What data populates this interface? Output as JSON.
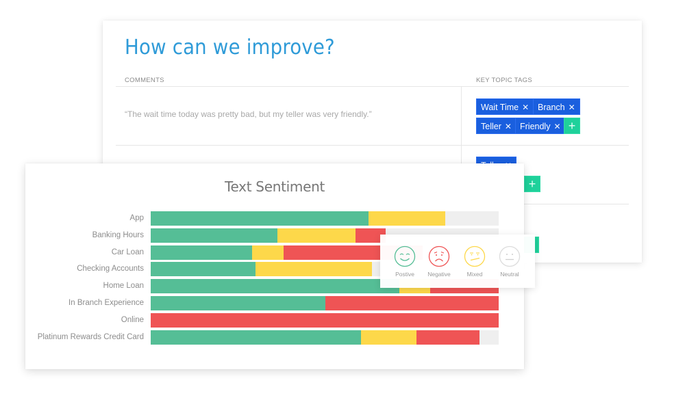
{
  "survey": {
    "title": "How can we improve?",
    "columns": {
      "comments": "COMMENTS",
      "tags": "KEY TOPIC TAGS"
    },
    "rows": [
      {
        "comment": "“The wait time today was pretty bad, but my teller was very friendly.”",
        "tags": [
          "Wait Time",
          "Branch",
          "Teller",
          "Friendly"
        ]
      },
      {
        "comment": "",
        "tags": [
          "Teller"
        ]
      }
    ],
    "tag_remove_glyph": "✕",
    "add_tag_glyph": "+"
  },
  "colors": {
    "title_blue": "#2f9bd8",
    "tag_blue": "#1a5fde",
    "add_green": "#1fd19b",
    "positive": "#55be96",
    "mixed": "#fdd84a",
    "negative": "#ef5455",
    "neutral": "#efefef"
  },
  "chart_data": {
    "type": "bar",
    "stacked": true,
    "orientation": "horizontal",
    "title": "Text Sentiment",
    "xlabel": "",
    "ylabel": "",
    "xlim": [
      0,
      100
    ],
    "unit": "percent of comments",
    "categories": [
      "App",
      "Banking Hours",
      "Car Loan",
      "Checking Accounts",
      "Home Loan",
      "In Branch Experience",
      "Online",
      "Platinum Rewards Credit Card"
    ],
    "series": [
      {
        "name": "Positive",
        "color": "#55be96",
        "values": [
          62.6,
          36.4,
          29.1,
          30.1,
          71.5,
          50.2,
          0,
          60.4
        ]
      },
      {
        "name": "Mixed",
        "color": "#fdd84a",
        "values": [
          22.0,
          22.4,
          9.1,
          33.5,
          8.9,
          0,
          0,
          16.0
        ]
      },
      {
        "name": "Negative",
        "color": "#ef5455",
        "values": [
          0,
          8.7,
          40.0,
          0,
          19.6,
          49.8,
          100,
          18.1
        ]
      },
      {
        "name": "Neutral",
        "color": "#efefef",
        "values": [
          15.4,
          32.5,
          21.8,
          36.4,
          0,
          0,
          0,
          5.5
        ]
      }
    ],
    "legend": {
      "placement": "overlay-right",
      "items": [
        {
          "label": "Postive",
          "icon": "smile-face-icon"
        },
        {
          "label": "Negative",
          "icon": "frown-face-icon"
        },
        {
          "label": "Mixed",
          "icon": "confused-face-icon"
        },
        {
          "label": "Neutral",
          "icon": "neutral-face-icon"
        }
      ]
    }
  }
}
